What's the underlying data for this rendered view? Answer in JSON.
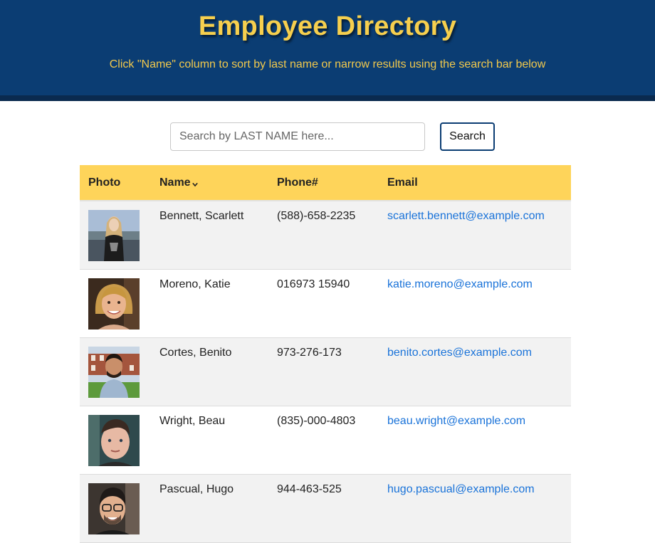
{
  "header": {
    "title": "Employee Directory",
    "subtitle": "Click \"Name\" column to sort by last name or narrow results using the search bar below"
  },
  "search": {
    "placeholder": "Search by LAST NAME here...",
    "value": "",
    "button_label": "Search"
  },
  "table": {
    "columns": {
      "photo": "Photo",
      "name": "Name",
      "phone": "Phone#",
      "email": "Email"
    },
    "rows": [
      {
        "name": "Bennett, Scarlett",
        "phone": "(588)-658-2235",
        "email": "scarlett.bennett@example.com"
      },
      {
        "name": "Moreno, Katie",
        "phone": "016973 15940",
        "email": "katie.moreno@example.com"
      },
      {
        "name": "Cortes, Benito",
        "phone": "973-276-173",
        "email": "benito.cortes@example.com"
      },
      {
        "name": "Wright, Beau",
        "phone": "(835)-000-4803",
        "email": "beau.wright@example.com"
      },
      {
        "name": "Pascual, Hugo",
        "phone": "944-463-525",
        "email": "hugo.pascual@example.com"
      }
    ]
  },
  "colors": {
    "header_bg": "#0b3d73",
    "title": "#f6cf4e",
    "table_header_bg": "#fed45a",
    "link": "#1a73d9"
  },
  "icons": {
    "sort": "chevron-down-icon"
  }
}
